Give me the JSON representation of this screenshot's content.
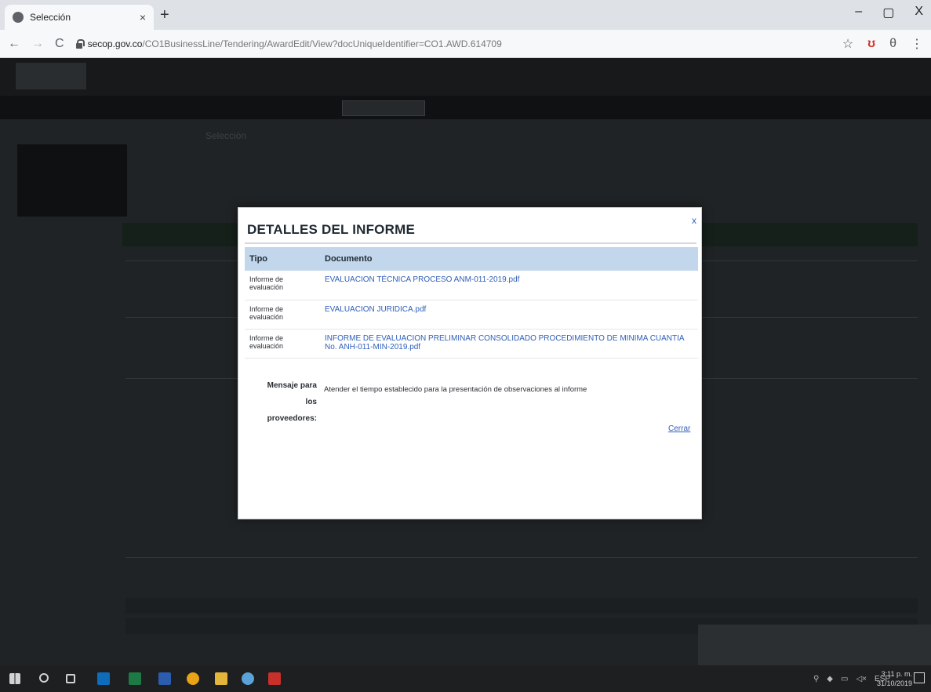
{
  "browser": {
    "tab_title": "Selección",
    "tab_close": "×",
    "new_tab": "+",
    "url_host": "secop.gov.co",
    "url_path": "/CO1BusinessLine/Tendering/AwardEdit/View?docUniqueIdentifier=CO1.AWD.614709",
    "minimize": "–",
    "maximize": "▢",
    "close": "X"
  },
  "page": {
    "breadcrumb": "Selección"
  },
  "modal": {
    "title": "DETALLES DEL INFORME",
    "close_label": "x",
    "columns": [
      "Tipo",
      "Documento"
    ],
    "rows": [
      {
        "tipo": "Informe de evaluación",
        "documento": "EVALUACION TÉCNICA PROCESO ANM-011-2019.pdf"
      },
      {
        "tipo": "Informe de evaluación",
        "documento": "EVALUACION JURIDICA.pdf"
      },
      {
        "tipo": "Informe de evaluación",
        "documento": "INFORME DE EVALUACION PRELIMINAR CONSOLIDADO PROCEDIMIENTO DE MINIMA CUANTIA No. ANH-011-MIN-2019.pdf"
      }
    ],
    "message_label": "Mensaje para los proveedores:",
    "message_text": "Atender el tiempo establecido para la presentación de observaciones al informe",
    "cerrar": "Cerrar"
  },
  "taskbar": {
    "language": "ESP",
    "time": "3:11 p. m.",
    "date": "31/10/2019"
  }
}
